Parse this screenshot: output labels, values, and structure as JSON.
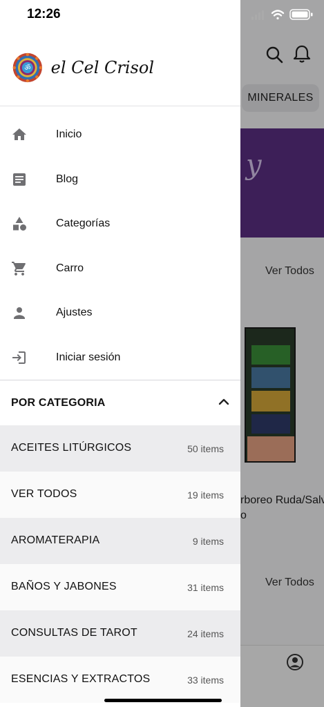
{
  "status_bar": {
    "time": "12:26"
  },
  "background": {
    "chip_label": "MINERALES",
    "banner_text": "y",
    "ver_todos_1": "Ver Todos",
    "ver_todos_2": "Ver Todos",
    "product_title_line1": "rboreo Ruda/Salv",
    "product_title_line2": "o"
  },
  "drawer": {
    "logo_text": "el Cel Crisol",
    "nav_items": [
      {
        "label": "Inicio",
        "icon": "home-icon"
      },
      {
        "label": "Blog",
        "icon": "article-icon"
      },
      {
        "label": "Categorías",
        "icon": "categories-icon"
      },
      {
        "label": "Carro",
        "icon": "cart-icon"
      },
      {
        "label": "Ajustes",
        "icon": "person-icon"
      },
      {
        "label": "Iniciar sesión",
        "icon": "login-icon"
      }
    ],
    "category_header": "POR CATEGORIA",
    "categories": [
      {
        "name": "ACEITES LITÚRGICOS",
        "count": "50 items"
      },
      {
        "name": "VER TODOS",
        "count": "19 items"
      },
      {
        "name": "AROMATERAPIA",
        "count": "9 items"
      },
      {
        "name": "BAÑOS Y JABONES",
        "count": "31 items"
      },
      {
        "name": "CONSULTAS DE TAROT",
        "count": "24 items"
      },
      {
        "name": "ESENCIAS Y EXTRACTOS",
        "count": "33 items"
      }
    ]
  },
  "colors": {
    "banner_purple": "#5b2f83",
    "row_shaded": "#ececee",
    "row_plain": "#fafafa"
  }
}
